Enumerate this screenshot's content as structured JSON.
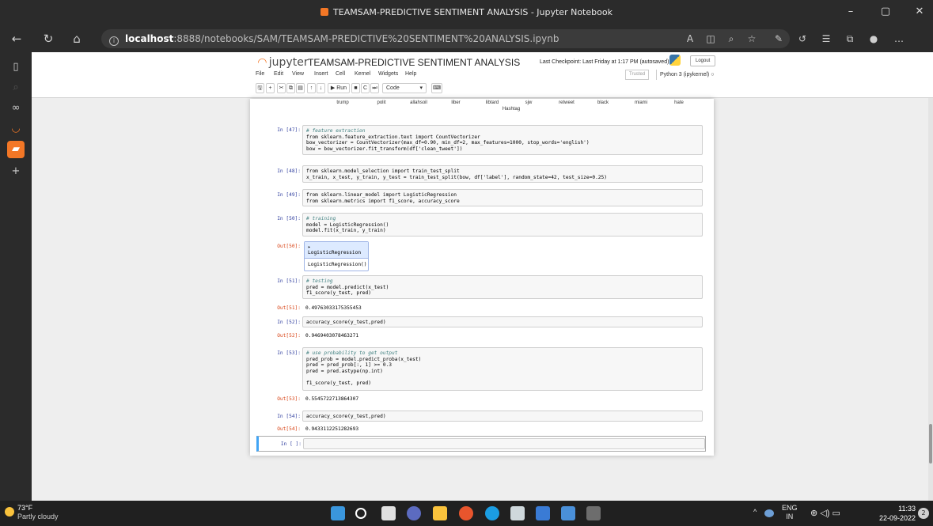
{
  "window": {
    "title": "TEAMSAM-PREDICTIVE SENTIMENT ANALYSIS - Jupyter Notebook",
    "minimize": "–",
    "restore": "▢",
    "close": "✕"
  },
  "browser": {
    "url_host": "localhost",
    "url_rest": ":8888/notebooks/SAM/TEAMSAM-PREDICTIVE%20SENTIMENT%20ANALYSIS.ipynb",
    "info_glyph": "i",
    "back_glyph": "←",
    "refresh_glyph": "↻",
    "home_glyph": "⌂",
    "more_glyph": "…",
    "toolbar_glyphs": [
      "A",
      "◫",
      "⌕",
      "☆",
      "✎",
      "↺",
      "☰",
      "⧉",
      "●",
      "…"
    ]
  },
  "sidebar": {
    "glyphs": [
      "▯",
      "⌕",
      "∞",
      "◡",
      "▰",
      "+"
    ]
  },
  "jupyter": {
    "logo_text": "jupyter",
    "notebook_title": "TEAMSAM-PREDICTIVE SENTIMENT ANALYSIS",
    "checkpoint": "Last Checkpoint: Last Friday at 1:17 PM  (autosaved)",
    "logout": "Logout",
    "menu": [
      "File",
      "Edit",
      "View",
      "Insert",
      "Cell",
      "Kernel",
      "Widgets",
      "Help"
    ],
    "trusted": "Trusted",
    "kernel": "Python 3 (ipykernel)  ○",
    "toolbar": {
      "save": "🖫",
      "add": "+",
      "cut": "✂",
      "copy": "⧉",
      "paste": "▤",
      "up": "↑",
      "down": "↓",
      "run": "▶ Run",
      "stop": "■",
      "restart": "C",
      "fast_forward": "⏭",
      "cell_type": "Code",
      "cell_type_arrow": "▾",
      "keyboard": "⌨"
    }
  },
  "chart_tail": {
    "ticks": [
      "trump",
      "polit",
      "allahsoil",
      "liber",
      "libtard",
      "sjw",
      "retweet",
      "black",
      "miami",
      "hate"
    ],
    "xlabel": "Hashtag"
  },
  "cells": [
    {
      "prompt": "In [47]:",
      "lines": [
        "# feature extraction",
        "from sklearn.feature_extraction.text import CountVectorizer",
        "bow_vectorizer = CountVectorizer(max_df=0.90, min_df=2, max_features=1000, stop_words='english')",
        "bow = bow_vectorizer.fit_transform(df['clean_tweet'])"
      ]
    },
    {
      "prompt": "In [48]:",
      "lines": [
        "from sklearn.model_selection import train_test_split",
        "x_train, x_test, y_train, y_test = train_test_split(bow, df['label'], random_state=42, test_size=0.25)"
      ]
    },
    {
      "prompt": "In [49]:",
      "lines": [
        "from sklearn.linear_model import LogisticRegression",
        "from sklearn.metrics import f1_score, accuracy_score"
      ]
    },
    {
      "prompt": "In [50]:",
      "lines": [
        "# training",
        "model = LogisticRegression()",
        "model.fit(x_train, y_train)"
      ],
      "out_prompt": "Out[50]:",
      "widget_head": "▸ LogisticRegression",
      "widget_body": "LogisticRegression()"
    },
    {
      "prompt": "In [51]:",
      "lines": [
        "# testing",
        "pred = model.predict(x_test)",
        "f1_score(y_test, pred)"
      ],
      "out_prompt": "Out[51]:",
      "out": "0.49763033175355453"
    },
    {
      "prompt": "In [52]:",
      "lines": [
        "accuracy_score(y_test,pred)"
      ],
      "out_prompt": "Out[52]:",
      "out": "0.9469403078463271"
    },
    {
      "prompt": "In [53]:",
      "lines": [
        "# use probability to get output",
        "pred_prob = model.predict_proba(x_test)",
        "pred = pred_prob[:, 1] >= 0.3",
        "pred = pred.astype(np.int)",
        "",
        "f1_score(y_test, pred)"
      ],
      "out_prompt": "Out[53]:",
      "out": "0.5545722713864307"
    },
    {
      "prompt": "In [54]:",
      "lines": [
        "accuracy_score(y_test,pred)"
      ],
      "out_prompt": "Out[54]:",
      "out": "0.9433112251282693"
    }
  ],
  "active_cell": {
    "prompt": "In [ ]:"
  },
  "taskbar": {
    "temperature": "73°F",
    "condition": "Partly cloudy",
    "tray_up": "^",
    "lang_top": "ENG",
    "lang_bottom": "IN",
    "tray_icons": "⊕ ◁) ▭",
    "time": "11:33",
    "date": "22-09-2022",
    "notifications": "2",
    "app_colors": [
      "#3a96dd",
      "#ffffff",
      "#e0e0e0",
      "#5c6bc0",
      "#f9c23c",
      "#e8552d",
      "#1b9de2",
      "#cfd8dc",
      "#3a7bd5",
      "#4a90d9",
      "#6d6d6d"
    ]
  }
}
